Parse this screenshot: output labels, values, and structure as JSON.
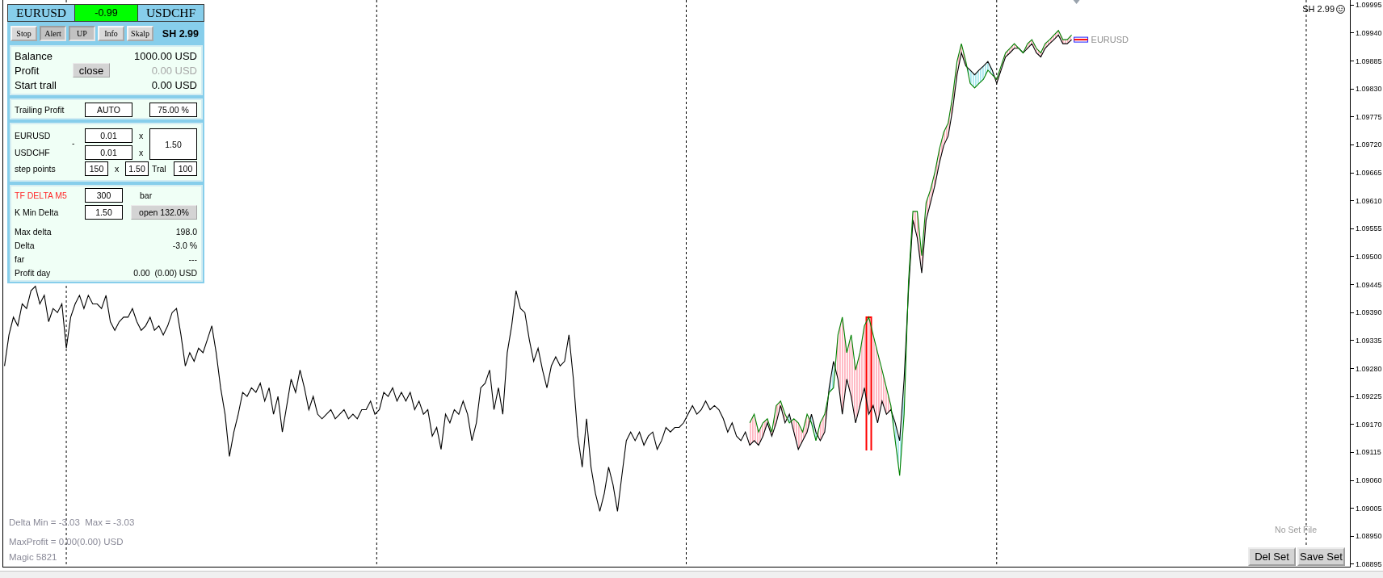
{
  "header": {
    "left_symbol": "EURUSD",
    "spread": "-0.99",
    "right_symbol": "USDCHF"
  },
  "toolbar": {
    "buttons": [
      {
        "label": "Stop",
        "pressed": false
      },
      {
        "label": "Alert",
        "pressed": true
      },
      {
        "label": "UP",
        "pressed": true
      },
      {
        "label": "Info",
        "pressed": false
      },
      {
        "label": "Skalp",
        "pressed": false
      }
    ],
    "version": "SH 2.99"
  },
  "account": [
    {
      "label": "Balance",
      "value": "1000.00 USD",
      "dimmed": false
    },
    {
      "label": "Profit",
      "button": "close",
      "value": "0.00 USD",
      "dimmed": true
    },
    {
      "label": "Start trall",
      "value": "0.00 USD",
      "dimmed": false
    }
  ],
  "trailing": {
    "label": "Trailing Profit",
    "mode": "AUTO",
    "percent": "75.00 %"
  },
  "lots": {
    "pairs": [
      {
        "symbol": "EURUSD",
        "lot": "0.01",
        "operator": "x"
      },
      {
        "symbol": "USDCHF",
        "lot": "0.01",
        "operator": "x"
      }
    ],
    "minus": "-",
    "ratio": "1.50",
    "step": {
      "label": "step points",
      "points": "150",
      "operator": "x",
      "multiplier": "1.50",
      "tral_label": "Tral",
      "tral": "100"
    }
  },
  "delta": {
    "timeframe": {
      "label": "TF DELTA M5",
      "bars": "300",
      "unit": "bar"
    },
    "k_min": {
      "label": "K Min Delta",
      "value": "1.50",
      "button": "open 132.0%"
    },
    "stats": [
      {
        "label": "Max delta",
        "value": "198.0"
      },
      {
        "label": "Delta",
        "value": "-3.0 %"
      },
      {
        "label": "far",
        "value": "---"
      },
      {
        "label": "Profit day",
        "value": "0.00  (0.00) USD"
      }
    ]
  },
  "chart": {
    "badge": "SH 2.99",
    "end_label": "EURUSD",
    "chart_data": {
      "type": "line",
      "ylim": [
        1.0889,
        1.10005
      ],
      "yticks": [
        {
          "value": 1.08895,
          "label": "1.08895"
        },
        {
          "value": 1.0895,
          "label": "1.08950"
        },
        {
          "value": 1.09005,
          "label": "1.09005"
        },
        {
          "value": 1.0906,
          "label": "1.09060"
        },
        {
          "value": 1.09115,
          "label": "1.09115"
        },
        {
          "value": 1.0917,
          "label": "1.09170"
        },
        {
          "value": 1.09225,
          "label": "1.09225"
        },
        {
          "value": 1.0928,
          "label": "1.09280"
        },
        {
          "value": 1.09335,
          "label": "1.09335"
        },
        {
          "value": 1.0939,
          "label": "1.09390"
        },
        {
          "value": 1.09445,
          "label": "1.09445"
        },
        {
          "value": 1.095,
          "label": "1.09500"
        },
        {
          "value": 1.09555,
          "label": "1.09555"
        },
        {
          "value": 1.0961,
          "label": "1.09610"
        },
        {
          "value": 1.09665,
          "label": "1.09665"
        },
        {
          "value": 1.0972,
          "label": "1.09720"
        },
        {
          "value": 1.09775,
          "label": "1.09775"
        },
        {
          "value": 1.0983,
          "label": "1.09830"
        },
        {
          "value": 1.09885,
          "label": "1.09885"
        },
        {
          "value": 1.0994,
          "label": "1.09940"
        },
        {
          "value": 1.09995,
          "label": "1.09995"
        }
      ],
      "series": [
        {
          "color": "#000000",
          "values": [
            1.09285,
            1.09346,
            1.09381,
            1.09364,
            1.09407,
            1.09398,
            1.09433,
            1.09442,
            1.09407,
            1.09424,
            1.09372,
            1.09398,
            1.0939,
            1.09407,
            1.0932,
            1.09381,
            1.09407,
            1.09424,
            1.09398,
            1.09424,
            1.09407,
            1.09407,
            1.09398,
            1.09424,
            1.09372,
            1.09355,
            1.09372,
            1.09381,
            1.09381,
            1.09398,
            1.09372,
            1.09355,
            1.09364,
            1.09381,
            1.09355,
            1.09364,
            1.09346,
            1.09364,
            1.0939,
            1.09398,
            1.09346,
            1.09285,
            1.09311,
            1.09294,
            1.0932,
            1.09311,
            1.09337,
            1.09364,
            1.09311,
            1.09242,
            1.0919,
            1.09107,
            1.09155,
            1.0919,
            1.09233,
            1.09225,
            1.09242,
            1.09233,
            1.09251,
            1.09216,
            1.09242,
            1.0919,
            1.09225,
            1.09155,
            1.09207,
            1.09259,
            1.09233,
            1.09277,
            1.09242,
            1.09199,
            1.09225,
            1.0919,
            1.09181,
            1.0919,
            1.09199,
            1.09181,
            1.0919,
            1.09199,
            1.09181,
            1.0919,
            1.09181,
            1.09199,
            1.09199,
            1.09216,
            1.0919,
            1.09199,
            1.09233,
            1.09225,
            1.09242,
            1.09216,
            1.09233,
            1.09216,
            1.09233,
            1.09199,
            1.09216,
            1.0919,
            1.09199,
            1.09147,
            1.09164,
            1.09121,
            1.0919,
            1.09173,
            1.09199,
            1.0919,
            1.09216,
            1.0919,
            1.09138,
            1.09173,
            1.09242,
            1.09251,
            1.09277,
            1.09199,
            1.09242,
            1.0919,
            1.09311,
            1.09364,
            1.09433,
            1.09398,
            1.0939,
            1.09337,
            1.09294,
            1.0932,
            1.09277,
            1.09242,
            1.09285,
            1.09303,
            1.09285,
            1.09294,
            1.09346,
            1.09259,
            1.09147,
            1.09086,
            1.09181,
            1.09086,
            1.09034,
            1.08999,
            1.09034,
            1.09086,
            1.09051,
            1.08999,
            1.09069,
            1.09138,
            1.09155,
            1.09138,
            1.09155,
            1.09129,
            1.09147,
            1.09155,
            1.09121,
            1.09138,
            1.09164,
            1.09155,
            1.09164,
            1.09164,
            1.09173,
            1.0919,
            1.09207,
            1.0919,
            1.09199,
            1.09216,
            1.09199,
            1.09207,
            1.09199,
            1.09181,
            1.09155,
            1.09173,
            1.09147,
            1.09138,
            1.09155,
            1.09129,
            1.09138,
            1.09129,
            1.09147,
            1.09173,
            1.09147,
            1.09173,
            1.09207,
            1.09173,
            1.0919,
            1.09155,
            1.09121,
            1.09138,
            1.09155,
            1.0919,
            1.09155,
            1.09138,
            1.09155,
            1.09242,
            1.09294,
            1.09259,
            1.0919,
            1.09259,
            1.09225,
            1.09173,
            1.09207,
            1.09242,
            1.0919,
            1.09207,
            1.09173,
            1.09216,
            1.0919,
            1.09199,
            1.09173,
            1.09138,
            1.09259,
            1.09433,
            1.09572,
            1.09537,
            1.09468,
            1.09572,
            1.09606,
            1.09641,
            1.09684,
            1.09719,
            1.09737,
            1.09789,
            1.09858,
            1.09901,
            1.09875,
            1.09867,
            1.09858,
            1.09867,
            1.09875,
            1.09884,
            1.09867,
            1.09841,
            1.09867,
            1.09893,
            1.09901,
            1.0991,
            1.0991,
            1.09901,
            1.0991,
            1.09919,
            1.09901,
            1.09893,
            1.0991,
            1.09919,
            1.09927,
            1.09936,
            1.09919,
            1.09919,
            1.09927
          ]
        },
        {
          "color": "#008000",
          "values": [
            null,
            null,
            null,
            null,
            null,
            null,
            null,
            null,
            null,
            null,
            null,
            null,
            null,
            null,
            null,
            null,
            null,
            null,
            null,
            null,
            null,
            null,
            null,
            null,
            null,
            null,
            null,
            null,
            null,
            null,
            null,
            null,
            null,
            null,
            null,
            null,
            null,
            null,
            null,
            null,
            null,
            null,
            null,
            null,
            null,
            null,
            null,
            null,
            null,
            null,
            null,
            null,
            null,
            null,
            null,
            null,
            null,
            null,
            null,
            null,
            null,
            null,
            null,
            null,
            null,
            null,
            null,
            null,
            null,
            null,
            null,
            null,
            null,
            null,
            null,
            null,
            null,
            null,
            null,
            null,
            null,
            null,
            null,
            null,
            null,
            null,
            null,
            null,
            null,
            null,
            null,
            null,
            null,
            null,
            null,
            null,
            null,
            null,
            null,
            null,
            null,
            null,
            null,
            null,
            null,
            null,
            null,
            null,
            null,
            null,
            null,
            null,
            null,
            null,
            null,
            null,
            null,
            null,
            null,
            null,
            null,
            null,
            null,
            null,
            null,
            null,
            null,
            null,
            null,
            null,
            null,
            null,
            null,
            null,
            null,
            null,
            null,
            null,
            null,
            null,
            null,
            null,
            null,
            null,
            null,
            null,
            null,
            null,
            null,
            null,
            null,
            null,
            null,
            null,
            null,
            null,
            null,
            null,
            null,
            null,
            null,
            null,
            null,
            null,
            null,
            null,
            null,
            null,
            null,
            1.09173,
            1.0919,
            1.09155,
            1.09173,
            1.09181,
            1.09155,
            1.09207,
            1.09216,
            1.0919,
            1.09173,
            1.09181,
            1.09173,
            1.09155,
            1.0919,
            1.09173,
            1.09138,
            1.09173,
            1.0919,
            1.09233,
            1.09242,
            1.09346,
            1.09381,
            1.09311,
            1.09346,
            1.09277,
            1.09311,
            1.09364,
            1.09381,
            1.09346,
            1.09311,
            1.09277,
            1.09242,
            1.09207,
            1.09138,
            1.09069,
            1.0919,
            1.0945,
            1.09589,
            1.09589,
            1.09502,
            1.09606,
            1.09632,
            1.09667,
            1.09711,
            1.09745,
            1.09763,
            1.09815,
            1.09884,
            1.09919,
            1.09884,
            1.09841,
            1.09832,
            1.09841,
            1.09849,
            1.09867,
            1.09858,
            1.09849,
            1.09875,
            1.09901,
            1.0991,
            1.09919,
            1.0991,
            1.09901,
            1.09919,
            1.09927,
            1.0991,
            1.09901,
            1.09919,
            1.09927,
            1.09936,
            1.09945,
            1.09927,
            1.09927,
            1.09936
          ]
        }
      ]
    }
  },
  "info_lines": [
    "Delta Min = -3.03  Max = -3.03",
    "MaxProfit = 0.00(0.00) USD",
    "Magic 5821"
  ],
  "set_file": {
    "status": "No Set File",
    "buttons": [
      "Del Set",
      "Save Set"
    ]
  }
}
